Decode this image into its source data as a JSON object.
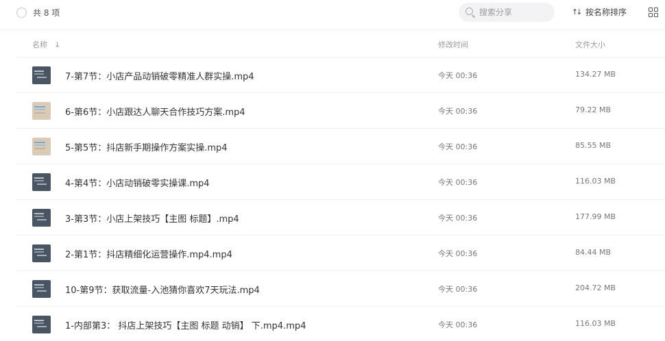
{
  "toolbar": {
    "count_label": "共 8 项",
    "search_placeholder": "搜索分享",
    "sort_label": "按名称排序"
  },
  "columns": {
    "name": "名称",
    "modified": "修改时间",
    "size": "文件大小"
  },
  "files": [
    {
      "name": "7-第7节：小店产品动销破零精准人群实操.mp4",
      "modified": "今天 00:36",
      "size": "134.27 MB"
    },
    {
      "name": "6-第6节：小店跟达人聊天合作技巧方案.mp4",
      "modified": "今天 00:36",
      "size": "79.22 MB"
    },
    {
      "name": "5-第5节：抖店新手期操作方案实操.mp4",
      "modified": "今天 00:36",
      "size": "85.55 MB"
    },
    {
      "name": "4-第4节：小店动销破零实操课.mp4",
      "modified": "今天 00:36",
      "size": "116.03 MB"
    },
    {
      "name": "3-第3节：小店上架技巧【主图 标题】.mp4",
      "modified": "今天 00:36",
      "size": "177.99 MB"
    },
    {
      "name": "2-第1节：抖店精细化运营操作.mp4.mp4",
      "modified": "今天 00:36",
      "size": "84.44 MB"
    },
    {
      "name": "10-第9节：获取流量-入池猜你喜欢7天玩法.mp4",
      "modified": "今天 00:36",
      "size": "204.72 MB"
    },
    {
      "name": "1-内部第3： 抖店上架技巧【主图 标题 动销】 下.mp4.mp4",
      "modified": "今天 00:36",
      "size": "116.03 MB"
    }
  ]
}
